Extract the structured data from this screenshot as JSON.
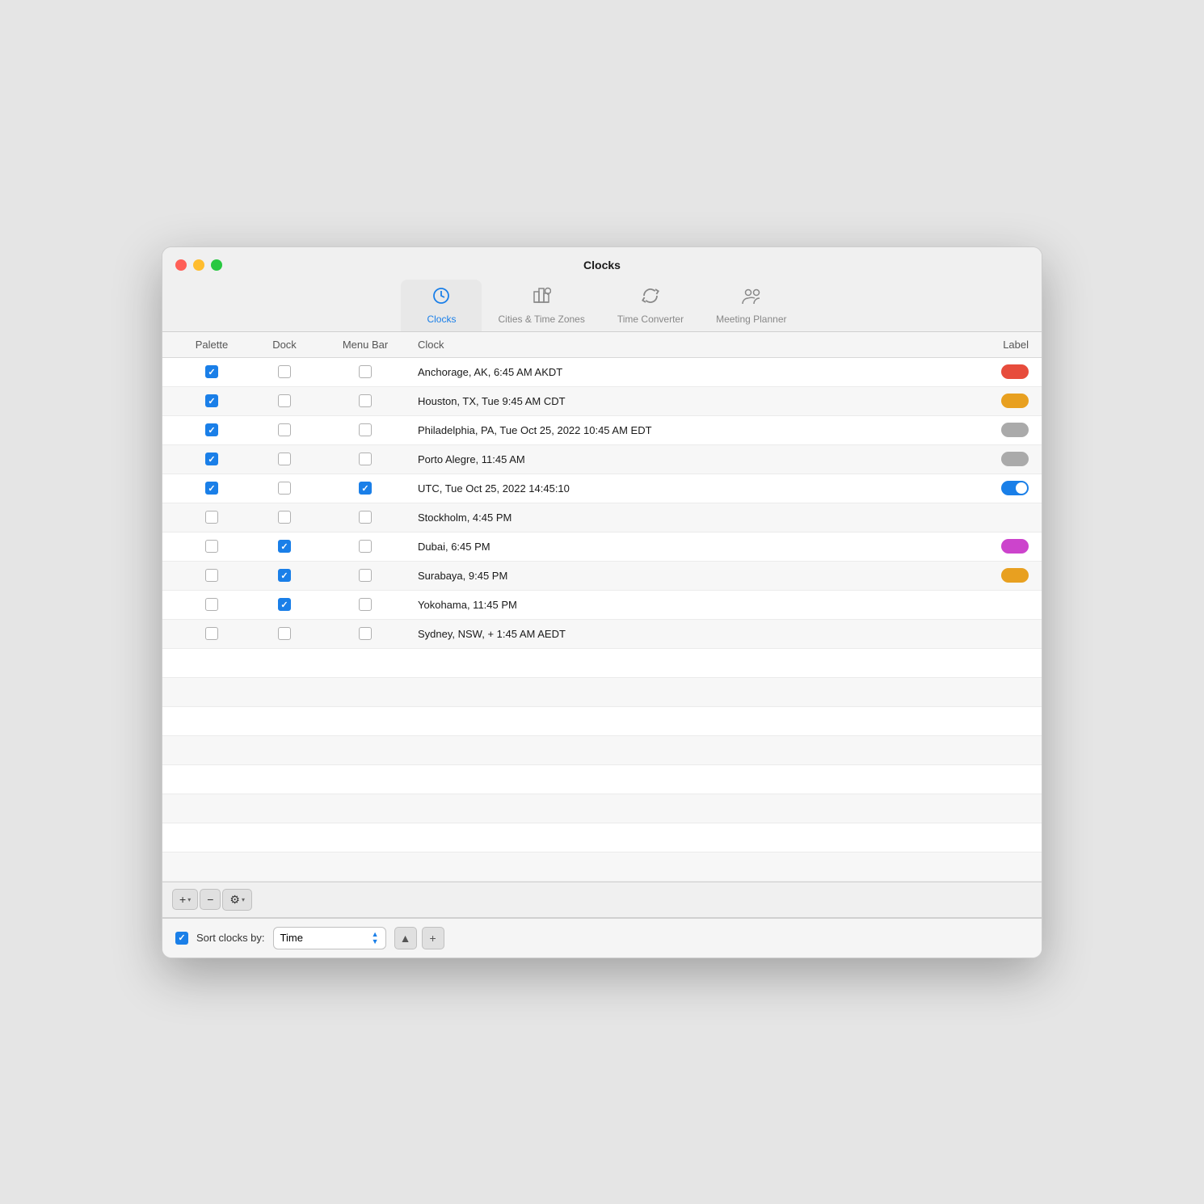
{
  "window": {
    "title": "Clocks"
  },
  "tabs": [
    {
      "id": "clocks",
      "label": "Clocks",
      "active": true,
      "icon": "clock"
    },
    {
      "id": "cities",
      "label": "Cities & Time Zones",
      "active": false,
      "icon": "cities"
    },
    {
      "id": "converter",
      "label": "Time Converter",
      "active": false,
      "icon": "converter"
    },
    {
      "id": "meeting",
      "label": "Meeting Planner",
      "active": false,
      "icon": "meeting"
    }
  ],
  "table": {
    "headers": {
      "palette": "Palette",
      "dock": "Dock",
      "menubar": "Menu Bar",
      "clock": "Clock",
      "label": "Label"
    },
    "rows": [
      {
        "palette": true,
        "dock": false,
        "menubar": false,
        "city": "Anchorage, AK, 6:45 AM AKDT",
        "labelType": "pill",
        "labelColor": "#e74c3c"
      },
      {
        "palette": true,
        "dock": false,
        "menubar": false,
        "city": "Houston, TX, Tue 9:45 AM CDT",
        "labelType": "pill",
        "labelColor": "#e8a020"
      },
      {
        "palette": true,
        "dock": false,
        "menubar": false,
        "city": "Philadelphia, PA, Tue Oct 25, 2022 10:45 AM EDT",
        "labelType": "pill",
        "labelColor": "#aaaaaa"
      },
      {
        "palette": true,
        "dock": false,
        "menubar": false,
        "city": "Porto Alegre, 11:45 AM",
        "labelType": "pill",
        "labelColor": "#aaaaaa"
      },
      {
        "palette": true,
        "dock": false,
        "menubar": true,
        "city": "UTC, Tue Oct 25, 2022 14:45:10",
        "labelType": "toggle",
        "labelColor": "#1a7fe8"
      },
      {
        "palette": false,
        "dock": false,
        "menubar": false,
        "city": "Stockholm, 4:45 PM",
        "labelType": "none",
        "labelColor": ""
      },
      {
        "palette": false,
        "dock": true,
        "menubar": false,
        "city": "Dubai, 6:45 PM",
        "labelType": "pill",
        "labelColor": "#cc44cc"
      },
      {
        "palette": false,
        "dock": true,
        "menubar": false,
        "city": "Surabaya, 9:45 PM",
        "labelType": "pill",
        "labelColor": "#e8a020"
      },
      {
        "palette": false,
        "dock": true,
        "menubar": false,
        "city": "Yokohama, 11:45 PM",
        "labelType": "none",
        "labelColor": ""
      },
      {
        "palette": false,
        "dock": false,
        "menubar": false,
        "city": "Sydney, NSW, + 1:45 AM AEDT",
        "labelType": "none",
        "labelColor": ""
      }
    ],
    "emptyRows": 6
  },
  "bottomToolbar": {
    "addLabel": "+",
    "removeLabel": "−",
    "gearLabel": "⚙"
  },
  "sortBar": {
    "checkboxChecked": true,
    "sortByLabel": "Sort clocks by:",
    "sortValue": "Time",
    "upArrow": "▲",
    "plusLabel": "+"
  }
}
